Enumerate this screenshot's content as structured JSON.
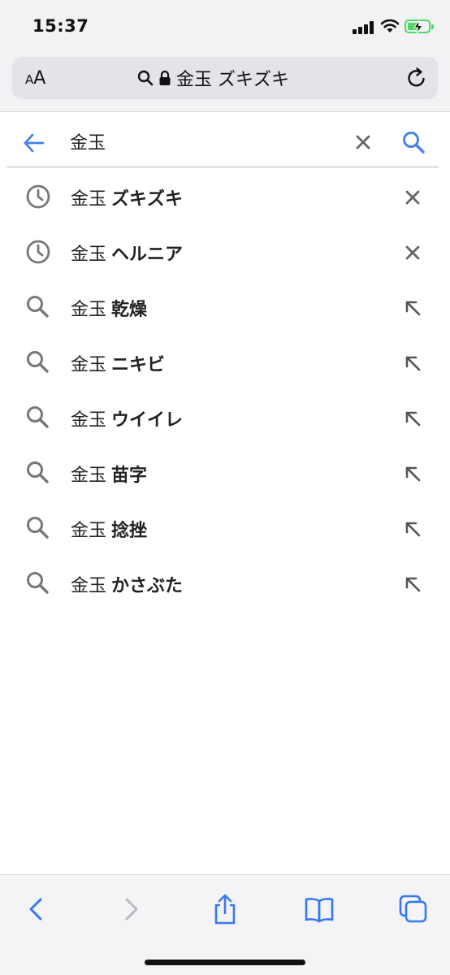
{
  "status_bar": {
    "time": "15:37"
  },
  "browser": {
    "text_size_label_small": "A",
    "text_size_label_large": "A",
    "url_display": "金玉 ズキズキ"
  },
  "search": {
    "query": "金玉",
    "accent_color": "#4a80e8"
  },
  "suggestions": [
    {
      "type": "history",
      "query": "金玉",
      "completion": "ズキズキ",
      "action": "remove"
    },
    {
      "type": "history",
      "query": "金玉",
      "completion": "ヘルニア",
      "action": "remove"
    },
    {
      "type": "search",
      "query": "金玉",
      "completion": "乾燥",
      "action": "fill"
    },
    {
      "type": "search",
      "query": "金玉",
      "completion": "ニキビ",
      "action": "fill"
    },
    {
      "type": "search",
      "query": "金玉",
      "completion": "ウイイレ",
      "action": "fill"
    },
    {
      "type": "search",
      "query": "金玉",
      "completion": "苗字",
      "action": "fill"
    },
    {
      "type": "search",
      "query": "金玉",
      "completion": "捻挫",
      "action": "fill"
    },
    {
      "type": "search",
      "query": "金玉",
      "completion": "かさぶた",
      "action": "fill"
    }
  ],
  "toolbar": {
    "icons": [
      "back-icon",
      "forward-icon",
      "share-icon",
      "bookmarks-icon",
      "tabs-icon"
    ],
    "tint_color": "#3478f6",
    "disabled_color": "#b9b9be"
  }
}
